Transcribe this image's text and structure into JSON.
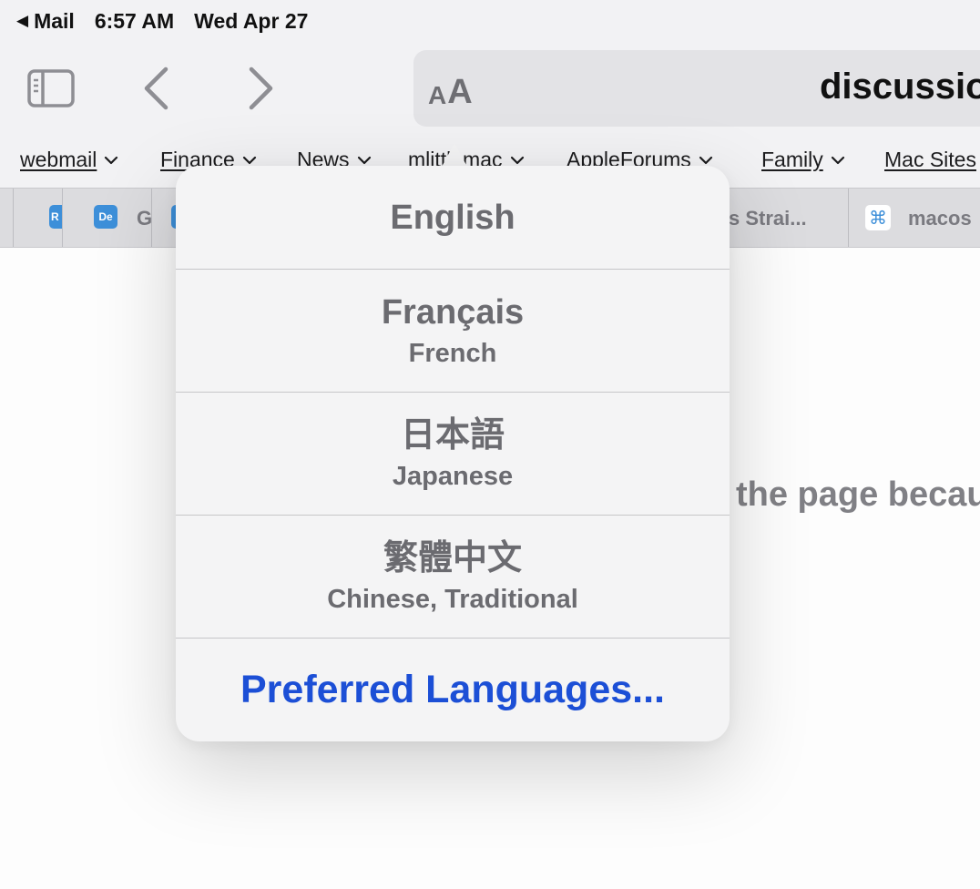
{
  "status_bar": {
    "back_app": "Mail",
    "time": "6:57 AM",
    "date": "Wed Apr 27"
  },
  "toolbar": {
    "reader_small": "A",
    "reader_big": "A",
    "url": "discussions.apple.com"
  },
  "bookmarks": [
    {
      "label": "webmail"
    },
    {
      "label": "Finance"
    },
    {
      "label": "News"
    },
    {
      "label": "mlittlemac"
    },
    {
      "label": "AppleForums"
    },
    {
      "label": "Family"
    },
    {
      "label": "Mac Sites"
    }
  ],
  "tabs": [
    {
      "favicon": "R",
      "title": ""
    },
    {
      "favicon": "De",
      "title": "G"
    },
    {
      "favicon": "",
      "title": ""
    },
    {
      "favicon": "",
      "title": "s Strai..."
    },
    {
      "favicon": "⌘",
      "title": "macos"
    }
  ],
  "page": {
    "message": "the page because"
  },
  "language_menu": {
    "options": [
      {
        "native": "English",
        "english": ""
      },
      {
        "native": "Français",
        "english": "French"
      },
      {
        "native": "日本語",
        "english": "Japanese"
      },
      {
        "native": "繁體中文",
        "english": "Chinese, Traditional"
      }
    ],
    "preferred_label": "Preferred Languages..."
  },
  "colors": {
    "accent_blue": "#1c4fd6",
    "icon_gray": "#8e8e93",
    "chrome_bg": "#f2f2f4"
  },
  "icons": {
    "sidebar": "sidebar-icon",
    "back": "chevron-left-icon",
    "forward": "chevron-right-icon",
    "dropdown": "chevron-down-icon"
  }
}
